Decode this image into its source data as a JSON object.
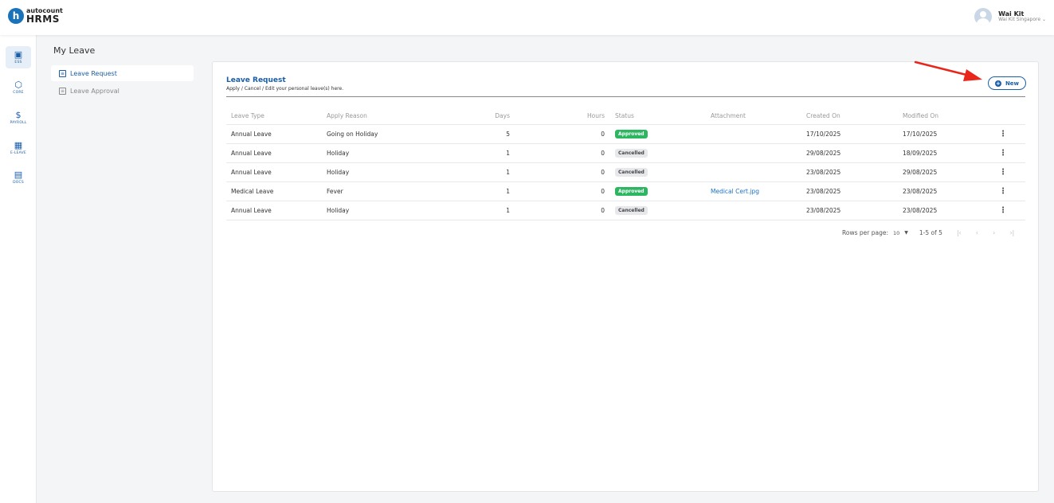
{
  "brand": {
    "logo_letter": "h",
    "logo_small": "autocount",
    "logo_big": "HRMS"
  },
  "user": {
    "name": "Wai Kit",
    "company": "Wai Kit Singapore",
    "company_caret": "⌄"
  },
  "rail": [
    {
      "label": "ESS",
      "icon": "ess-icon",
      "glyph": "▣"
    },
    {
      "label": "CORE",
      "icon": "core-icon",
      "glyph": "⬡"
    },
    {
      "label": "PAYROLL",
      "icon": "payroll-icon",
      "glyph": "$"
    },
    {
      "label": "E-LEAVE",
      "icon": "calendar-icon",
      "glyph": "▦"
    },
    {
      "label": "DOCS",
      "icon": "docs-icon",
      "glyph": "▤"
    }
  ],
  "page_title": "My Leave",
  "subnav": [
    {
      "label": "Leave Request",
      "icon": "document-icon"
    },
    {
      "label": "Leave Approval",
      "icon": "document-icon"
    }
  ],
  "card": {
    "title": "Leave Request",
    "subtitle": "Apply / Cancel / Edit your personal leave(s) here.",
    "new_button": "New",
    "plus_glyph": "+"
  },
  "table": {
    "headers": {
      "type": "Leave Type",
      "reason": "Apply Reason",
      "days": "Days",
      "hours": "Hours",
      "status": "Status",
      "attachment": "Attachment",
      "created": "Created On",
      "modified": "Modified On"
    },
    "menu_glyph": "⋮",
    "rows": [
      {
        "type": "Annual Leave",
        "reason": "Going on Holiday",
        "days": "5",
        "hours": "0",
        "status": "Approved",
        "attachment": "",
        "created": "17/10/2025",
        "modified": "17/10/2025"
      },
      {
        "type": "Annual Leave",
        "reason": "Holiday",
        "days": "1",
        "hours": "0",
        "status": "Cancelled",
        "attachment": "",
        "created": "29/08/2025",
        "modified": "18/09/2025"
      },
      {
        "type": "Annual Leave",
        "reason": "Holiday",
        "days": "1",
        "hours": "0",
        "status": "Cancelled",
        "attachment": "",
        "created": "23/08/2025",
        "modified": "29/08/2025"
      },
      {
        "type": "Medical Leave",
        "reason": "Fever",
        "days": "1",
        "hours": "0",
        "status": "Approved",
        "attachment": "Medical Cert.jpg",
        "created": "23/08/2025",
        "modified": "23/08/2025"
      },
      {
        "type": "Annual Leave",
        "reason": "Holiday",
        "days": "1",
        "hours": "0",
        "status": "Cancelled",
        "attachment": "",
        "created": "23/08/2025",
        "modified": "23/08/2025"
      }
    ]
  },
  "pagination": {
    "rows_per_page_label": "Rows per page:",
    "rows_per_page_value": "10",
    "caret": "▼",
    "range": "1-5 of 5",
    "first": "|‹",
    "prev": "‹",
    "next": "›",
    "last": "›|"
  },
  "colors": {
    "accent": "#1a5ea8",
    "approved": "#2db661",
    "arrow": "#e8261c"
  }
}
